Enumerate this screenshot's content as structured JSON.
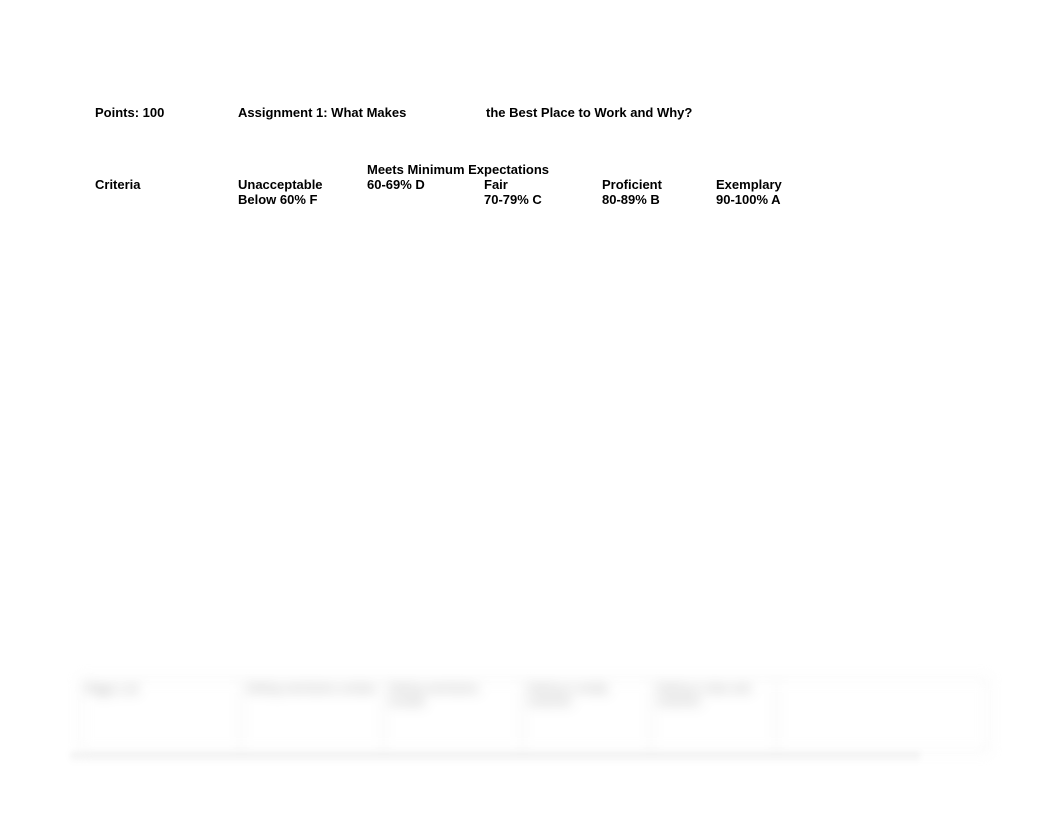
{
  "document": {
    "points_label": "Points: 100",
    "assignment_title_part1": "Assignment 1: What Makes",
    "assignment_title_part2": "the Best Place to Work and Why?"
  },
  "rubric": {
    "criteria_header": "Criteria",
    "levels": [
      {
        "name": "Unacceptable",
        "range": "Below 60% F"
      },
      {
        "name": "Meets Minimum\nExpectations",
        "range": "60-69% D"
      },
      {
        "name": "Fair",
        "range": "70-79% C"
      },
      {
        "name": "Proficient",
        "range": "80-89% B"
      },
      {
        "name": "Exemplary",
        "range": "90-100% A"
      }
    ]
  },
  "partial_row": {
    "note": "partially rendered row at page bottom (blurred)",
    "cells": [
      "Page 1 of",
      "Writing\nmechanics\nunclear",
      "Writing\nmechanics\nunclear",
      "Writing is\nmostly\ncoherent",
      "Writing is\nclear and\ncoherent",
      ""
    ]
  },
  "colors": {
    "text": "#000000",
    "page_background": "#ffffff",
    "table_border": "#c8c8c8",
    "muted_text": "#555555"
  }
}
